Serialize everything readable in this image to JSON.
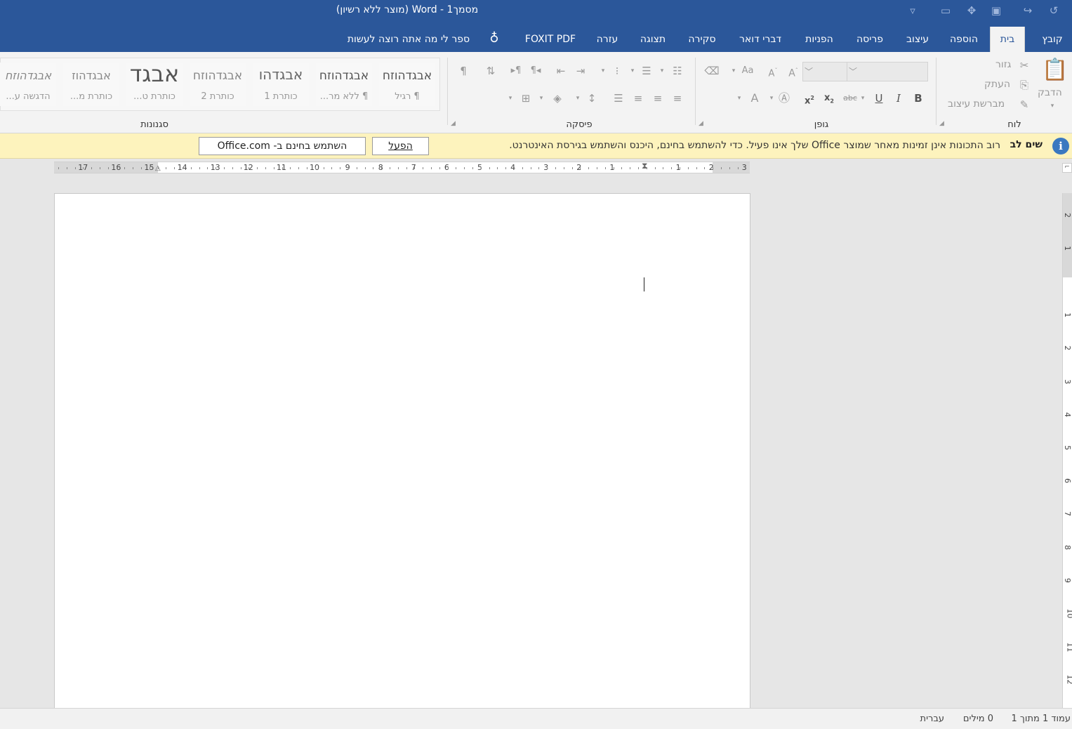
{
  "title_bar": {
    "title": "מסמך1  -  Word (מוצר ללא רשיון)",
    "quick_access": {
      "undo_icon": "undo-icon",
      "redo_icon": "redo-icon",
      "save_icon": "save-icon",
      "customize_icon": "customize-icon"
    }
  },
  "tabs": [
    {
      "label": "קובץ"
    },
    {
      "label": "בית"
    },
    {
      "label": "הוספה"
    },
    {
      "label": "עיצוב"
    },
    {
      "label": "פריסה"
    },
    {
      "label": "הפניות"
    },
    {
      "label": "דברי דואר"
    },
    {
      "label": "סקירה"
    },
    {
      "label": "תצוגה"
    },
    {
      "label": "עזרה"
    },
    {
      "label": "FOXIT PDF"
    }
  ],
  "tell_me": "ספר לי מה אתה רוצה לעשות",
  "ribbon": {
    "clipboard": {
      "group": "לוח",
      "paste": "הדבק",
      "cut": "גזור",
      "copy": "העתק",
      "format_painter": "מברשת עיצוב"
    },
    "font": {
      "group": "גופן",
      "font_size_value": "",
      "font_name_value": ""
    },
    "paragraph": {
      "group": "פיסקה"
    },
    "styles": {
      "group": "סגנונות",
      "items": [
        {
          "preview": "אבגדהוזח",
          "name": "¶ רגיל"
        },
        {
          "preview": "אבגדהוזח",
          "name": "¶ ללא מר..."
        },
        {
          "preview": "אבגדהו",
          "name": "כותרת 1"
        },
        {
          "preview": "אבגדהוזח",
          "name": "כותרת 2"
        },
        {
          "preview": "אבגד",
          "name": "כותרת ט..."
        },
        {
          "preview": "אבגדהוז",
          "name": "כותרת מ..."
        },
        {
          "preview": "אבגדהוזח",
          "name": "הדגשה ע..."
        }
      ]
    }
  },
  "message_bar": {
    "title": "שים לב",
    "text": "רוב התכונות אינן זמינות מאחר שמוצר Office שלך אינו פעיל. כדי להשתמש בחינם, היכנס והשתמש בגירסת האינטרנט.",
    "activate_button": "הפעל",
    "online_button": "השתמש בחינם ב- Office.com"
  },
  "ruler": {
    "left_numbers": [
      "17",
      "16",
      "15",
      "14",
      "13",
      "12",
      "11",
      "10",
      "9",
      "8",
      "7",
      "6",
      "5",
      "4",
      "3",
      "2",
      "1"
    ],
    "right_numbers": [
      "1",
      "2",
      "3"
    ],
    "vertical_numbers": [
      "2",
      "1",
      "1",
      "2",
      "3",
      "4",
      "5",
      "6",
      "7",
      "8",
      "9",
      "10",
      "11",
      "12"
    ]
  },
  "status_bar": {
    "page": "עמוד 1 מתוך 1",
    "words": "0 מילים",
    "language": "עברית"
  }
}
